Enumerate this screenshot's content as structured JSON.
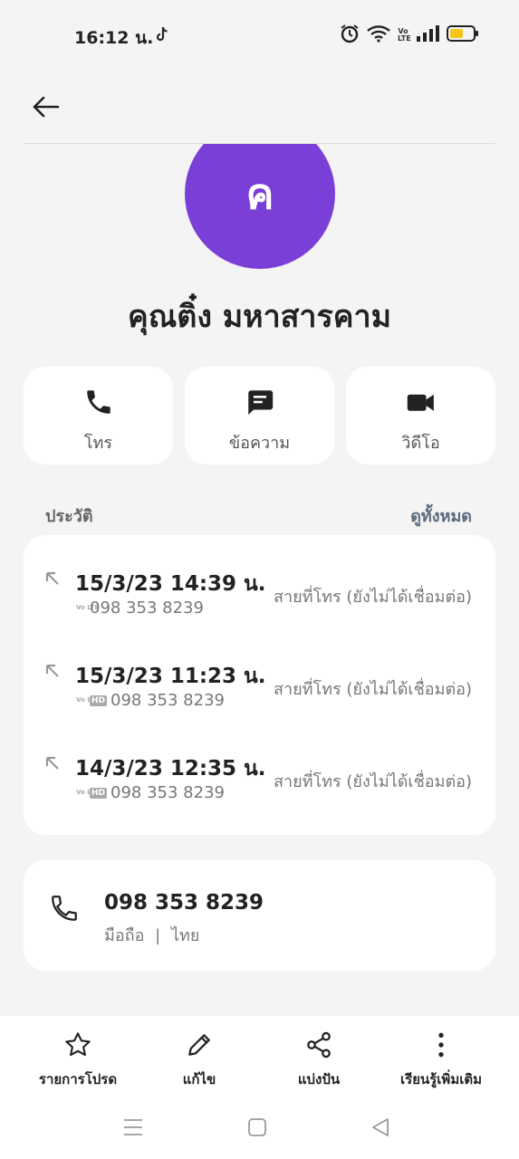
{
  "status_bar": {
    "time": "16:12 น.",
    "volte": "Vo LTE",
    "icons": [
      "tiktok-icon",
      "alarm-icon",
      "wifi-icon",
      "volte-icon",
      "signal-icon",
      "battery-icon"
    ]
  },
  "header": {
    "back_icon": "back-arrow-icon"
  },
  "contact": {
    "avatar_letter": "ค",
    "avatar_color": "#7a3fd6",
    "name": "คุณติ๋ง มหาสารคาม"
  },
  "actions": [
    {
      "label": "โทร",
      "icon": "phone-icon"
    },
    {
      "label": "ข้อความ",
      "icon": "message-icon"
    },
    {
      "label": "วิดีโอ",
      "icon": "video-icon"
    }
  ],
  "history": {
    "title": "ประวัติ",
    "view_all": "ดูทั้งหมด",
    "calls": [
      {
        "datetime": "15/3/23 14:39 น.",
        "number": "098 353 8239",
        "status": "สายที่โทร (ยังไม่ได้เชื่อมต่อ)",
        "volte": "Vo LTE",
        "hd": ""
      },
      {
        "datetime": "15/3/23 11:23 น.",
        "number": "098 353 8239",
        "status": "สายที่โทร (ยังไม่ได้เชื่อมต่อ)",
        "volte": "Vo LTE",
        "hd": "HD"
      },
      {
        "datetime": "14/3/23 12:35 น.",
        "number": "098 353 8239",
        "status": "สายที่โทร (ยังไม่ได้เชื่อมต่อ)",
        "volte": "Vo LTE",
        "hd": "HD"
      }
    ]
  },
  "phone_number": {
    "number": "098 353 8239",
    "type": "มือถือ",
    "separator": "|",
    "country": "ไทย"
  },
  "toolbar": [
    {
      "label": "รายการโปรด",
      "icon": "star-icon"
    },
    {
      "label": "แก้ไข",
      "icon": "pencil-icon"
    },
    {
      "label": "แบ่งปัน",
      "icon": "share-icon"
    },
    {
      "label": "เรียนรู้เพิ่มเติม",
      "icon": "more-vertical-icon"
    }
  ],
  "nav_bar": {
    "icons": [
      "recents-icon",
      "home-icon",
      "back-icon"
    ]
  },
  "colors": {
    "accent": "#7a3fd6",
    "background": "#f4f4f4",
    "card": "#ffffff"
  }
}
